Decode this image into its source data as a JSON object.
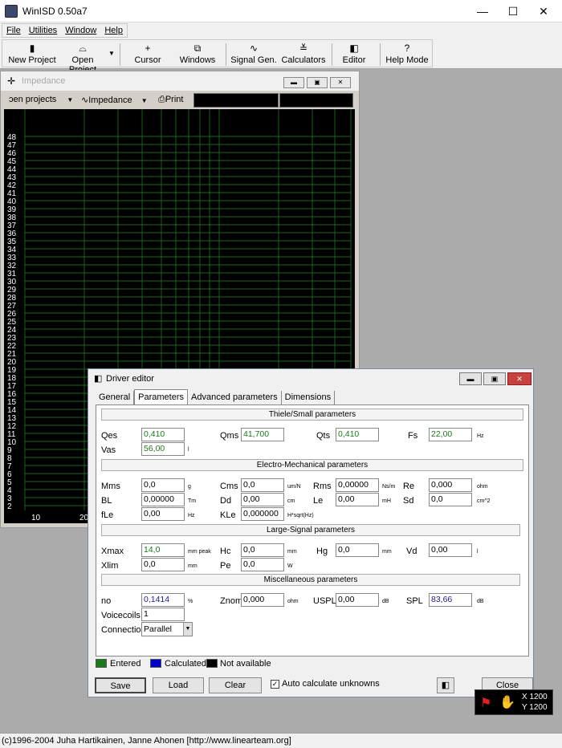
{
  "window": {
    "title": "WinISD 0.50a7",
    "minimize": "—",
    "maximize": "☐",
    "close": "✕"
  },
  "menu": [
    "File",
    "Utilities",
    "Window",
    "Help"
  ],
  "toolbar": [
    {
      "label": "New Project",
      "icon": "new-project-icon"
    },
    {
      "label": "Open Project",
      "icon": "open-project-icon"
    },
    {
      "label": "Cursor",
      "icon": "cursor-icon"
    },
    {
      "label": "Windows",
      "icon": "windows-icon"
    },
    {
      "label": "Signal Gen.",
      "icon": "signal-gen-icon"
    },
    {
      "label": "Calculators",
      "icon": "calculators-icon"
    },
    {
      "label": "Editor",
      "icon": "editor-icon"
    },
    {
      "label": "Help Mode",
      "icon": "help-mode-icon"
    }
  ],
  "impedance": {
    "title": "Impedance",
    "open_projects": "ɔen projects",
    "graph_select": "Impedance",
    "print": "Print",
    "y_ticks": [
      48,
      47,
      46,
      45,
      44,
      43,
      42,
      41,
      40,
      39,
      38,
      37,
      36,
      35,
      34,
      33,
      32,
      31,
      30,
      29,
      28,
      27,
      26,
      25,
      24,
      23,
      22,
      21,
      20,
      19,
      18,
      17,
      16,
      15,
      14,
      13,
      12,
      11,
      10,
      9,
      8,
      7,
      6,
      5,
      4,
      3,
      2
    ],
    "x_ticks": [
      "10",
      "20"
    ],
    "colors": {
      "grid": "#1f8a1f",
      "background": "#000000",
      "text": "#ffffff"
    }
  },
  "editor": {
    "title": "Driver editor",
    "tabs": [
      "General",
      "Parameters",
      "Advanced parameters",
      "Dimensions"
    ],
    "active_tab": "Parameters",
    "sections": {
      "ts": "Thiele/Small parameters",
      "em": "Electro-Mechanical parameters",
      "ls": "Large-Signal parameters",
      "misc": "Miscellaneous parameters"
    },
    "fields": {
      "qes": {
        "label": "Qes",
        "value": "0,410",
        "state": "entered"
      },
      "qms": {
        "label": "Qms",
        "value": "41,700",
        "state": "entered"
      },
      "qts": {
        "label": "Qts",
        "value": "0,410",
        "state": "entered"
      },
      "fs": {
        "label": "Fs",
        "value": "22,00",
        "unit": "Hz",
        "state": "entered"
      },
      "vas": {
        "label": "Vas",
        "value": "56,00",
        "unit": "l",
        "state": "entered"
      },
      "mms": {
        "label": "Mms",
        "value": "0,0",
        "unit": "g"
      },
      "cms": {
        "label": "Cms",
        "value": "0,0",
        "unit": "um/N"
      },
      "rms": {
        "label": "Rms",
        "value": "0,00000",
        "unit": "Ns/m"
      },
      "re": {
        "label": "Re",
        "value": "0,000",
        "unit": "ohm"
      },
      "bl": {
        "label": "BL",
        "value": "0,00000",
        "unit": "Tm"
      },
      "dd": {
        "label": "Dd",
        "value": "0,00",
        "unit": "cm"
      },
      "le": {
        "label": "Le",
        "value": "0,00",
        "unit": "mH"
      },
      "sd": {
        "label": "Sd",
        "value": "0,0",
        "unit": "cm^2"
      },
      "fle": {
        "label": "fLe",
        "value": "0,00",
        "unit": "Hz"
      },
      "kle": {
        "label": "KLe",
        "value": "0,000000",
        "unit": "H*sqrt(Hz)"
      },
      "xmax": {
        "label": "Xmax",
        "value": "14,0",
        "unit": "mm  peak",
        "state": "entered"
      },
      "hc": {
        "label": "Hc",
        "value": "0,0",
        "unit": "mm"
      },
      "hg": {
        "label": "Hg",
        "value": "0,0",
        "unit": "mm"
      },
      "vd": {
        "label": "Vd",
        "value": "0,00",
        "unit": "l"
      },
      "xlim": {
        "label": "Xlim",
        "value": "0,0",
        "unit": "mm"
      },
      "pe": {
        "label": "Pe",
        "value": "0,0",
        "unit": "W"
      },
      "no": {
        "label": "no",
        "value": "0,1414",
        "unit": "%",
        "state": "calculated"
      },
      "znom": {
        "label": "Znom",
        "value": "0,000",
        "unit": "ohm"
      },
      "uspl": {
        "label": "USPL",
        "value": "0,00",
        "unit": "dB"
      },
      "spl": {
        "label": "SPL",
        "value": "83,66",
        "unit": "dB",
        "state": "calculated"
      },
      "voicecoils": {
        "label": "Voicecoils",
        "value": "1"
      },
      "connection": {
        "label": "Connection",
        "value": "Parallel"
      }
    },
    "legend": {
      "entered": "Entered",
      "calculated": "Calculated",
      "not_available": "Not available",
      "colors": {
        "entered": "#1a7a1a",
        "calculated": "#0000cc",
        "not_available": "#000000"
      }
    },
    "buttons": {
      "save": "Save",
      "load": "Load",
      "clear": "Clear",
      "auto_calc": "Auto calculate unknowns",
      "close": "Close"
    },
    "auto_calc_checked": "✓"
  },
  "coords": {
    "x": "X 1200",
    "y": "Y 1200"
  },
  "status": "(c)1996-2004 Juha Hartikainen, Janne Ahonen [http://www.linearteam.org]"
}
